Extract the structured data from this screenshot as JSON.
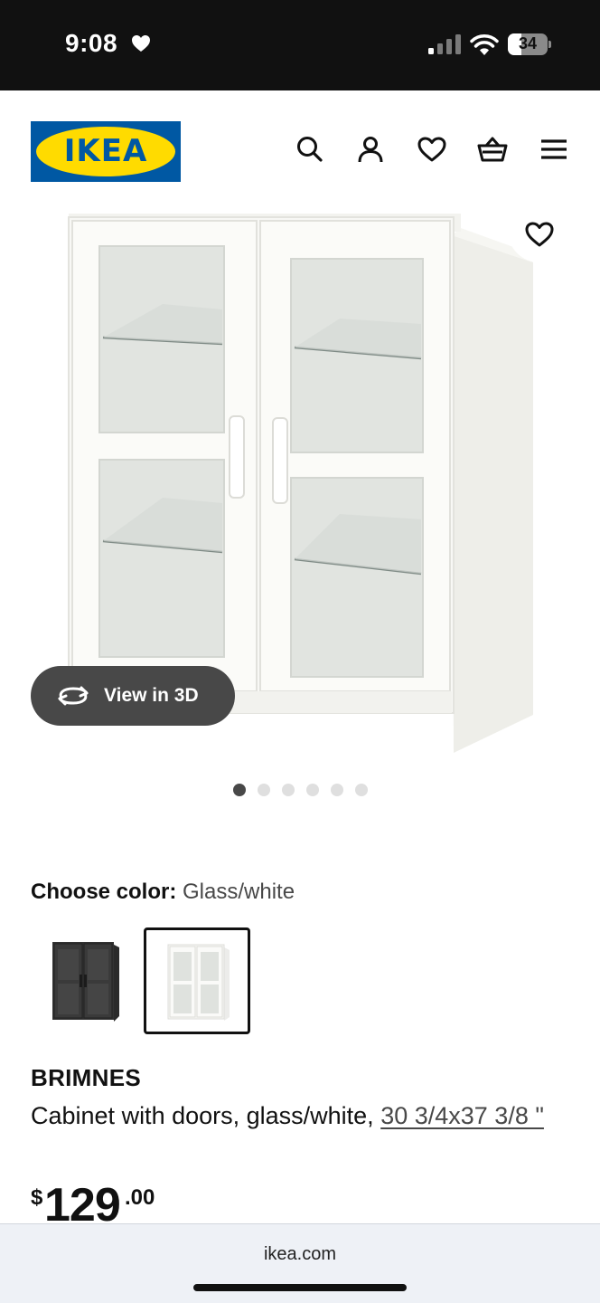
{
  "status_bar": {
    "time": "9:08",
    "battery_level": "34",
    "icons": [
      "heart-icon",
      "signal-icon",
      "wifi-icon",
      "battery-icon"
    ]
  },
  "header": {
    "logo_text": "IKEA",
    "icons": [
      "search-icon",
      "account-icon",
      "heart-icon",
      "cart-icon",
      "menu-icon"
    ],
    "colors": {
      "logo_blue": "#0058a3",
      "logo_yellow": "#ffdb00"
    }
  },
  "gallery": {
    "view_3d_label": "View in 3D",
    "image_count": 6,
    "active_image_index": 0,
    "favorite_icon": "heart-outline-icon",
    "view_3d_icon": "rotate-3d-icon"
  },
  "color_picker": {
    "label": "Choose color:",
    "selected_value": "Glass/white",
    "swatches": [
      {
        "name": "black",
        "selected": false
      },
      {
        "name": "glass-white",
        "selected": true
      }
    ]
  },
  "product": {
    "name": "BRIMNES",
    "description": "Cabinet with doors, glass/white, ",
    "size": "30 3/4x37 3/8 \"",
    "price": {
      "currency": "$",
      "integer": "129",
      "decimal": ".00"
    }
  },
  "browser": {
    "url": "ikea.com"
  }
}
